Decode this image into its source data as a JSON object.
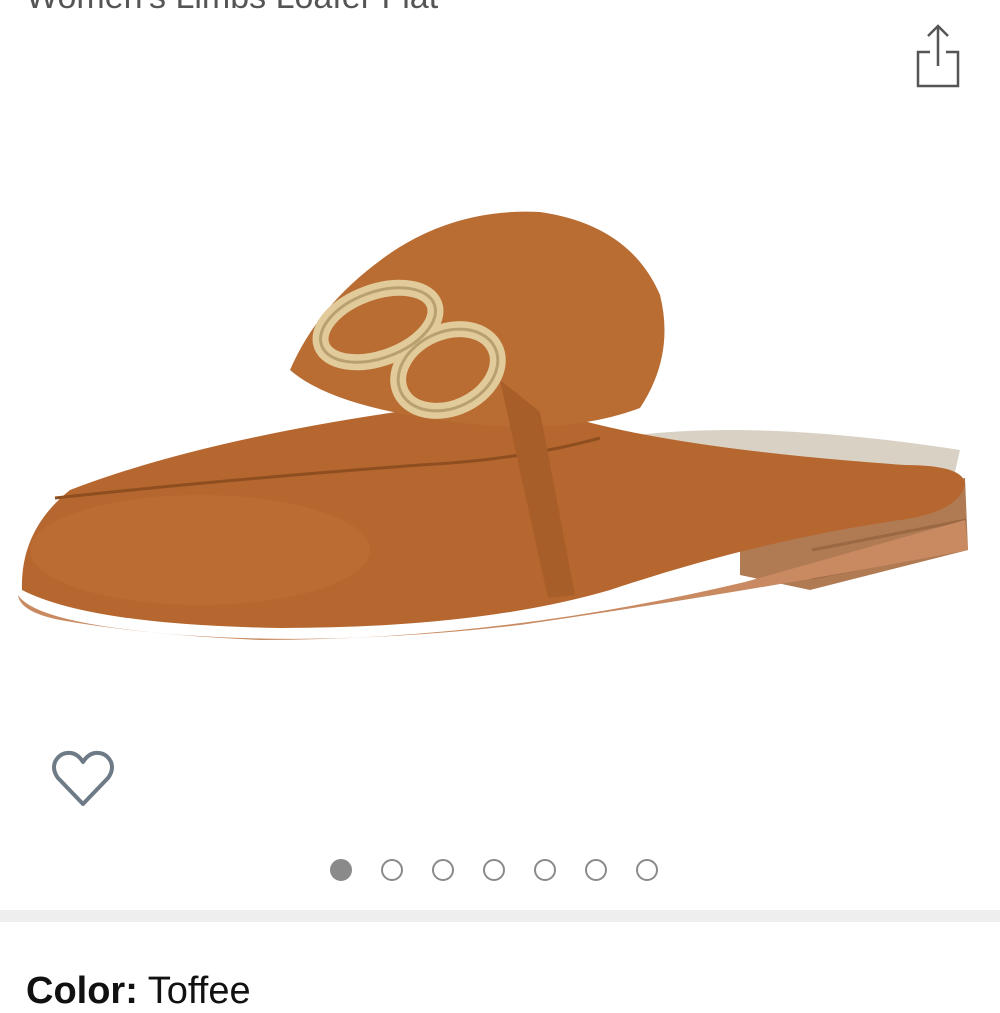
{
  "product": {
    "title": "Women's Limbs Loafer Flat",
    "image_alt": "Toffee suede loafer mule with gold chain link",
    "share_icon": "share-icon",
    "wishlist_icon": "heart-outline-icon"
  },
  "carousel": {
    "total": 7,
    "active_index": 0
  },
  "color": {
    "label": "Color:",
    "value": "Toffee"
  },
  "colors": {
    "suede": "#B5672F",
    "sole": "#C98A62",
    "gold": "#E2CB9B",
    "icon_gray": "#6E7B86",
    "dot_gray": "#8A8A8A"
  }
}
